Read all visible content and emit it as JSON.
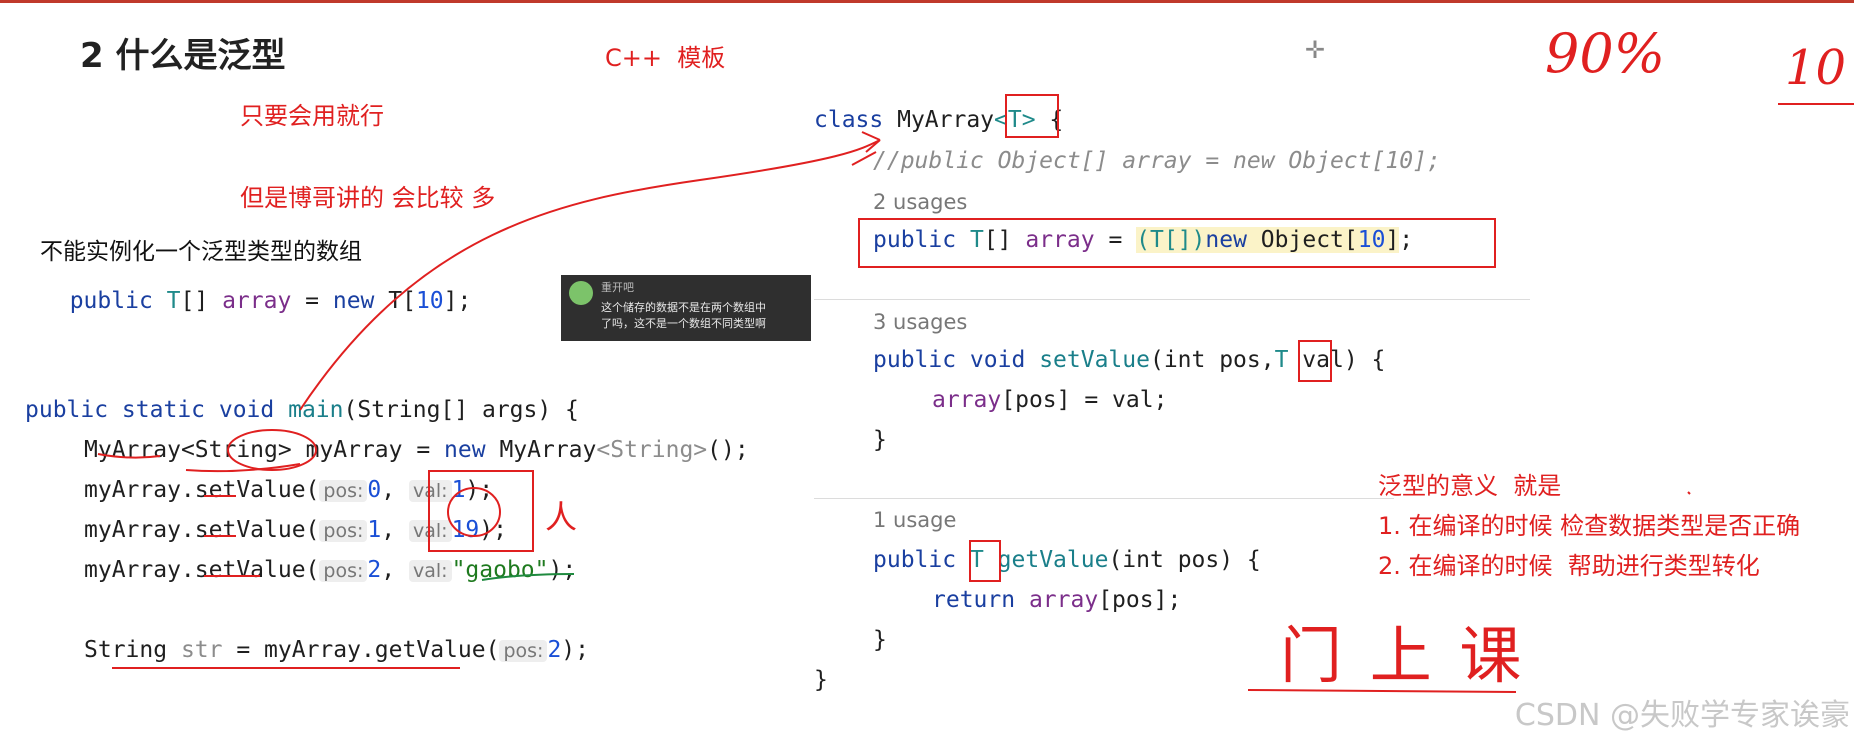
{
  "slide": {
    "title": "2 什么是泛型",
    "cpp_template": "C++  模板",
    "note_use": "只要会用就行",
    "note_more": "但是博哥讲的 会比较 多",
    "no_instantiate": "不能实例化一个泛型类型的数组"
  },
  "left_code": {
    "l1_kw": "public",
    "l1_type": "T",
    "l1_rest": "[] ",
    "l1_field": "array",
    "l1_eq": " = ",
    "l1_new": "new",
    "l1_t2": " T[",
    "l1_num": "10",
    "l1_end": "];",
    "main_kw": "public static void",
    "main_name": "main",
    "main_rest": "(String[] args) {",
    "m1_a": "MyArray",
    "m1_b": "<String>",
    "m1_c": " myArray = ",
    "m1_new": "new",
    "m1_d": " MyArray",
    "m1_e": "<String>",
    "m1_f": "();",
    "call": "myArray.setValue(",
    "hint_pos": "pos:",
    "hint_val": "val:",
    "c1_pos": "0",
    "c1_val": "1",
    "c2_pos": "1",
    "c2_val": "19",
    "c3_pos": "2",
    "c3_val": "\"gaobo\"",
    "close": ");",
    "comma": ",",
    "get_a": "String ",
    "get_b": "str",
    "get_c": " = myArray.getValue(",
    "get_pos": "2"
  },
  "right_code": {
    "class_kw": "class",
    "class_name": " MyArray",
    "class_t": "<T>",
    "class_end": " {",
    "comment": "//public Object[] array = new Object[10];",
    "usage1": "2 usages",
    "a_kw": "public",
    "a_t": "T",
    "a_rest": "[] ",
    "a_field": "array",
    "a_eq": " = ",
    "a_cast": "(T[])",
    "a_new": "new",
    "a_obj": " Object[",
    "a_num": "10",
    "a_close": "]",
    "a_end": ";",
    "usage2": "3 usages",
    "s_kw": "public void",
    "s_name": "setValue",
    "s_args1": "(int pos,",
    "s_t": "T",
    "s_args2": " val) {",
    "s_body_field": "array",
    "s_body_rest": "[pos] = val;",
    "brace": "}",
    "usage3": "1 usage",
    "g_kw": "public",
    "g_t": "T",
    "g_name": "getValue",
    "g_args": "(int pos) {",
    "g_ret": "return",
    "g_field": "array",
    "g_rest": "[pos];",
    "class_close": "}"
  },
  "meaning": {
    "title": "泛型的意义  就是",
    "item1": "1. 在编译的时候 检查数据类型是否正确",
    "item2": "2. 在编译的时候  帮助进行类型转化"
  },
  "tooltip": {
    "name": "重开吧",
    "line1": "这个储存的数据不是在两个数组中",
    "line2": "了吗，这不是一个数组不同类型啊"
  },
  "handwriting": {
    "percent": "90%",
    "ten": "10",
    "person": "人",
    "class_text": "门 上 课"
  },
  "watermark": "CSDN @失败学专家诶豪"
}
